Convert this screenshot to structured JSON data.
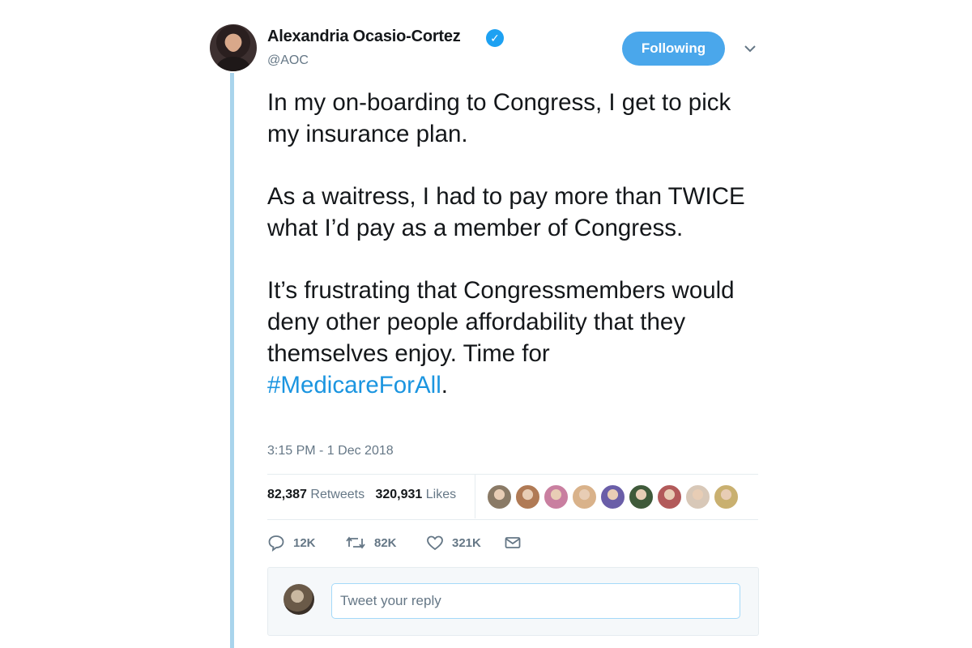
{
  "author": {
    "name": "Alexandria Ocasio-Cortez",
    "handle": "@AOC",
    "verified_icon": "verified-badge-icon"
  },
  "follow_button": {
    "label": "Following"
  },
  "tweet": {
    "paragraphs": [
      "In my on-boarding to Congress, I get to pick my insurance plan.",
      "As a waitress, I had to pay more than TWICE what I’d pay as a member of Congress.",
      "It’s frustrating that Congressmembers would deny other people affordability that they themselves enjoy. Time for"
    ],
    "hashtag": "#MedicareForAll",
    "hashtag_suffix": ".",
    "timestamp": "3:15 PM - 1 Dec 2018"
  },
  "stats": {
    "retweets_count": "82,387",
    "retweets_label": "Retweets",
    "likes_count": "320,931",
    "likes_label": "Likes"
  },
  "likers": [
    "#8a7a66",
    "#b07a55",
    "#c97fa0",
    "#d9b28a",
    "#6a5ea8",
    "#3f5a3a",
    "#b25a5a",
    "#d8c8b8",
    "#c9b070"
  ],
  "actions": {
    "reply_count": "12K",
    "retweet_count": "82K",
    "like_count": "321K"
  },
  "reply": {
    "placeholder": "Tweet your reply"
  },
  "colors": {
    "accent": "#1da1f2",
    "hashtag": "#1b95e0",
    "thread_line": "#a9d4ec",
    "muted_text": "#657786"
  }
}
